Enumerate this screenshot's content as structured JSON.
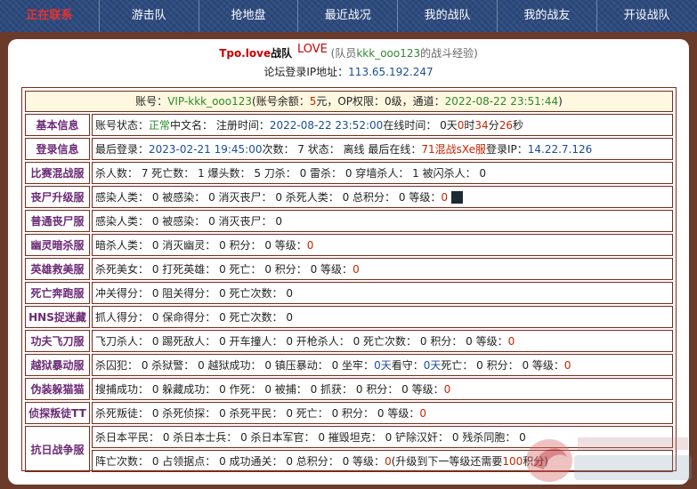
{
  "nav": {
    "items": [
      "正在联系",
      "游击队",
      "抢地盘",
      "最近战况",
      "我的战队",
      "我的战友",
      "开设战队"
    ]
  },
  "header": {
    "team_name": "Tpo.love",
    "team_suffix": "战队",
    "love_tag": "LOVE",
    "member_prefix": "(队员",
    "member_name": "kkk_ooo123",
    "member_suffix": "的战斗经验)",
    "ip_label": "论坛登录IP地址：",
    "ip_value": "113.65.192.247"
  },
  "account": {
    "label": "账号：",
    "value": "VIP-kkk_ooo123",
    "balance_label": "(账号余额：",
    "balance": "5",
    "op_label": "元，OP权限：0级，通道：",
    "date": "2022-08-22 23:51:44",
    "close": ")"
  },
  "rows": [
    {
      "label": "基本信息",
      "parts": [
        {
          "t": "账号状态："
        },
        {
          "t": "正常",
          "c": "dgreen"
        },
        {
          "t": " 中文名： 注册时间： "
        },
        {
          "t": "2022-08-22 23:52:00",
          "c": "blue"
        },
        {
          "t": " 在线时间： 0天"
        },
        {
          "t": "0",
          "c": "red"
        },
        {
          "t": "时"
        },
        {
          "t": "34",
          "c": "red"
        },
        {
          "t": "分"
        },
        {
          "t": "26",
          "c": "red"
        },
        {
          "t": "秒"
        }
      ]
    },
    {
      "label": "登录信息",
      "parts": [
        {
          "t": "最后登录： "
        },
        {
          "t": "2023-02-21 19:45:00",
          "c": "blue"
        },
        {
          "t": " 次数： 7  状态： 离线 最后在线： "
        },
        {
          "t": "71混战sXe服",
          "c": "red"
        },
        {
          "t": " 登录IP： "
        },
        {
          "t": "14.22.7.126",
          "c": "blue"
        }
      ]
    },
    {
      "label": "比赛混战服",
      "parts": [
        {
          "t": "杀人数： 7  死亡数： 1  爆头数： 5  刀杀： 0  雷杀： 0  穿墙杀人： 1  被闪杀人： 0"
        }
      ]
    },
    {
      "label": "丧尸升级服",
      "avatar": true,
      "parts": [
        {
          "t": "感染人类： 0  被感染： 0  消灭丧尸： 0  杀死人类： 0  总积分： 0  等级： "
        },
        {
          "t": "0",
          "c": "red"
        }
      ]
    },
    {
      "label": "普通丧尸服",
      "parts": [
        {
          "t": "感染人类： 0  被感染： 0  消灭丧尸： 0"
        }
      ]
    },
    {
      "label": "幽灵暗杀服",
      "parts": [
        {
          "t": "暗杀人类： 0  消灭幽灵： 0  积分： 0  等级： "
        },
        {
          "t": "0",
          "c": "red"
        }
      ]
    },
    {
      "label": "英雄救美服",
      "parts": [
        {
          "t": "杀死美女： 0  打死英雄： 0  死亡： 0  积分： 0  等级： "
        },
        {
          "t": "0",
          "c": "red"
        }
      ]
    },
    {
      "label": "死亡奔跑服",
      "parts": [
        {
          "t": "冲关得分： 0  阻关得分： 0  死亡次数： 0"
        }
      ]
    },
    {
      "label": "HNS捉迷藏",
      "parts": [
        {
          "t": "抓人得分： 0  保命得分： 0  死亡次数： 0"
        }
      ]
    },
    {
      "label": "功夫飞刀服",
      "parts": [
        {
          "t": "飞刀杀人： 0  踢死敌人： 0  开车撞人： 0  开枪杀人： 0  死亡次数： 0  积分： 0  等级： "
        },
        {
          "t": "0",
          "c": "red"
        }
      ]
    },
    {
      "label": "越狱暴动服",
      "parts": [
        {
          "t": "杀囚犯： 0  杀狱警： 0  越狱成功： 0  镇压暴动： 0  坐牢： "
        },
        {
          "t": "0天",
          "c": "blue"
        },
        {
          "t": " 看守： "
        },
        {
          "t": "0天",
          "c": "blue"
        },
        {
          "t": " 死亡： 0  积分： 0  等级： "
        },
        {
          "t": "0",
          "c": "red"
        }
      ]
    },
    {
      "label": "伪装躲猫猫",
      "parts": [
        {
          "t": "搜捕成功： 0  躲藏成功： 0  作死： 0  被捕： 0  抓获： 0  积分： 0  等级： "
        },
        {
          "t": "0",
          "c": "red"
        }
      ]
    },
    {
      "label": "侦探叛徒TT",
      "parts": [
        {
          "t": "杀死叛徒： 0  杀死侦探： 0  杀死平民： 0  死亡： 0  积分： 0  等级： "
        },
        {
          "t": "0",
          "c": "red"
        }
      ]
    }
  ],
  "war_row": {
    "label": "抗日战争服",
    "line1": [
      {
        "t": "杀日本平民： 0  杀日本士兵： 0  杀日本军官： 0  摧毁坦克： 0  铲除汉奸： 0  残杀同胞： 0"
      }
    ],
    "line2": [
      {
        "t": "阵亡次数： 0  占领据点： 0  成功通关： 0  总积分： 0  等级： "
      },
      {
        "t": "0",
        "c": "red"
      },
      {
        "t": " (升级到下一等级还需要"
      },
      {
        "t": "100",
        "c": "red"
      },
      {
        "t": "积分)"
      }
    ]
  },
  "colors": {
    "nav_bg": "#2c4a7e",
    "frame": "#6a3a2a",
    "label": "#6a2a75",
    "accent": "#cc0000"
  }
}
